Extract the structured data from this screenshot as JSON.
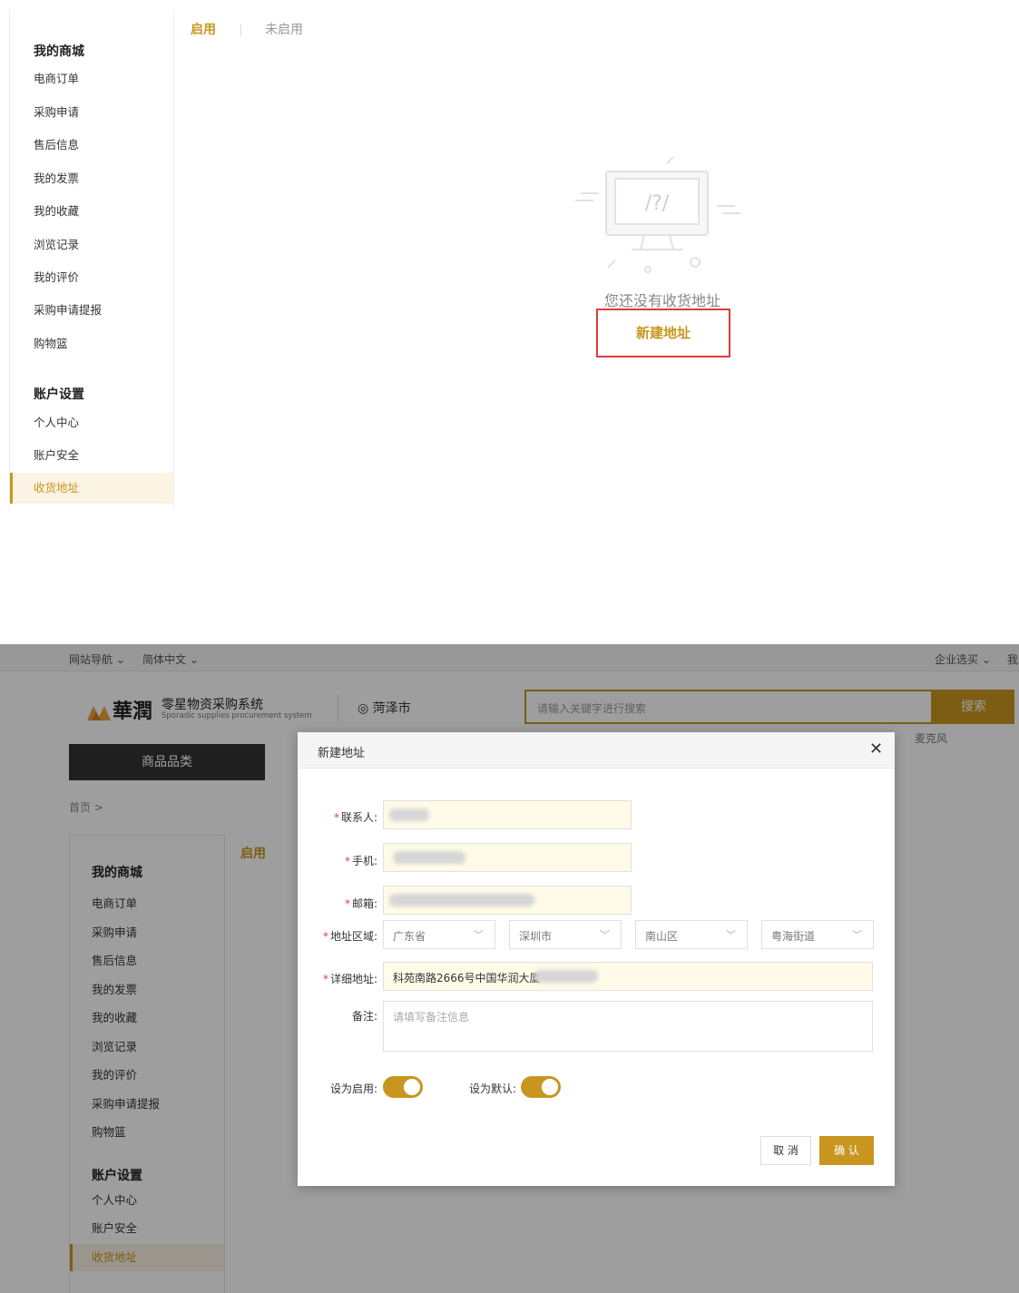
{
  "top": {
    "sidebar": {
      "section1_title": "我的商城",
      "section1_items": [
        "电商订单",
        "采购申请",
        "售后信息",
        "我的发票",
        "我的收藏",
        "浏览记录",
        "我的评价",
        "采购申请提报",
        "购物篮"
      ],
      "section2_title": "账户设置",
      "section2_items": [
        "个人中心",
        "账户安全",
        "收货地址"
      ],
      "active_item": "收货地址"
    },
    "tabs": {
      "enabled": "启用",
      "disabled": "未启用"
    },
    "empty": {
      "message": "您还没有收货地址",
      "new_button": "新建地址",
      "icon": "empty-computer-question-icon"
    }
  },
  "bottom": {
    "topbar": {
      "nav": "网站导航",
      "lang": "简体中文",
      "enterprise": "企业选买",
      "my": "我"
    },
    "header": {
      "brand": "華潤",
      "system_name": "零星物资采购系统",
      "system_sub": "Sporadic supplies procurement system",
      "location": "菏泽市",
      "search_placeholder": "请输入关键字进行搜索",
      "search_button": "搜索",
      "hotword": "麦克风"
    },
    "category_button": "商品品类",
    "breadcrumb": "首页 >",
    "tab": "启用",
    "sidebar": {
      "section1_title": "我的商城",
      "section1_items": [
        "电商订单",
        "采购申请",
        "售后信息",
        "我的发票",
        "我的收藏",
        "浏览记录",
        "我的评价",
        "采购申请提报",
        "购物篮"
      ],
      "section2_title": "账户设置",
      "section2_items": [
        "个人中心",
        "账户安全",
        "收货地址"
      ]
    },
    "dialog": {
      "title": "新建地址",
      "labels": {
        "contact": "联系人:",
        "phone": "手机:",
        "email": "邮箱:",
        "region": "地址区域:",
        "detail": "详细地址:",
        "remark": "备注:",
        "enable": "设为启用:",
        "default": "设为默认:"
      },
      "region": {
        "province": "广东省",
        "city": "深圳市",
        "district": "南山区",
        "street": "粤海街道"
      },
      "detail_value": "科苑南路2666号中国华润大厦",
      "remark_placeholder": "请填写备注信息",
      "enable_on": true,
      "default_on": true,
      "cancel": "取 消",
      "confirm": "确 认"
    }
  },
  "colors": {
    "accent": "#c8961f",
    "highlight_border": "#e03a3a",
    "required": "#e03a3a",
    "dark_button": "#333333"
  }
}
